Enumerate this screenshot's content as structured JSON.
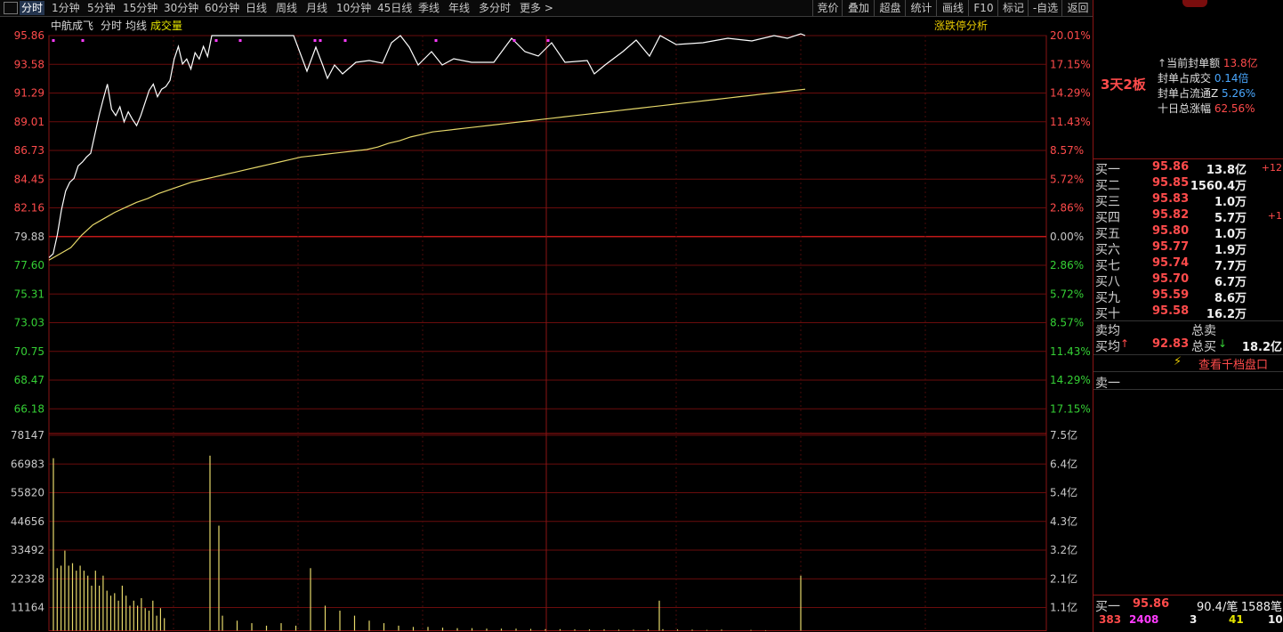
{
  "toolbar": {
    "tabs": [
      "分时",
      "1分钟",
      "5分钟",
      "15分钟",
      "30分钟",
      "60分钟",
      "日线",
      "周线",
      "月线",
      "10分钟",
      "45日线",
      "季线",
      "年线",
      "多分时",
      "更多 >"
    ],
    "active_tab": "分时",
    "right_buttons": [
      "竞价",
      "叠加",
      "超盘",
      "统计",
      "画线",
      "F10",
      "标记",
      "-自选",
      "返回"
    ]
  },
  "chart_header": {
    "stock_name": "中航成飞",
    "labels": [
      "分时",
      "均线",
      "成交量"
    ],
    "right_label": "涨跌停分析"
  },
  "price_axis": {
    "left": [
      "95.86",
      "93.58",
      "91.29",
      "89.01",
      "86.73",
      "84.45",
      "82.16",
      "79.88",
      "77.60",
      "75.31",
      "73.03",
      "70.75",
      "68.47",
      "66.18"
    ],
    "right": [
      "20.01%",
      "17.15%",
      "14.29%",
      "11.43%",
      "8.57%",
      "5.72%",
      "2.86%",
      "0.00%",
      "2.86%",
      "5.72%",
      "8.57%",
      "11.43%",
      "14.29%",
      "17.15%"
    ]
  },
  "volume_axis": {
    "left": [
      "78147",
      "66983",
      "55820",
      "44656",
      "33492",
      "22328",
      "11164"
    ],
    "right": [
      "7.5亿",
      "6.4亿",
      "5.4亿",
      "4.3亿",
      "3.2亿",
      "2.1亿",
      "1.1亿"
    ]
  },
  "chart_data": {
    "type": "line",
    "prev_close": 79.88,
    "ylim": [
      66.18,
      95.86
    ],
    "x_minutes": 240,
    "series": [],
    "price": [
      78.2,
      78.5,
      80,
      82,
      83.5,
      84.2,
      84.5,
      85.5,
      85.8,
      86.2,
      86.5,
      88,
      89.5,
      90.8,
      92,
      90,
      89.5,
      90.2,
      89,
      89.8,
      89.2,
      88.7,
      89.5,
      90.5,
      91.5,
      92,
      91,
      91.6,
      91.8,
      92.3,
      94,
      95,
      93.6,
      94,
      93.2,
      94.5,
      94,
      95,
      94.2,
      95.86,
      95.86,
      95.86,
      95.86,
      95.86,
      95.86,
      95.86,
      95.86,
      95.86,
      95.86,
      95.86,
      95.86,
      95.86,
      95.86,
      95.86,
      95.86,
      95.86,
      95.86,
      95.86,
      95.86,
      95.86,
      95.86,
      95.86,
      95.86,
      95.86,
      95.86,
      95.86,
      95.86,
      95.86,
      95.86,
      95.86,
      95.86,
      95.86,
      95.86,
      95.86,
      95.86,
      95.86,
      95.86,
      95.86,
      95.86,
      95.86,
      95.86,
      95.86,
      95.86,
      95.86,
      95.86,
      95.86,
      95.86,
      95.86,
      95.86,
      95.86,
      95.86,
      95.86,
      95.86,
      95.86,
      95.86,
      95.86,
      95.86,
      95.86,
      95.86,
      95.86,
      95.86,
      95.86,
      95.86,
      95.86,
      95.86,
      95.86,
      95.86,
      95.86,
      95.86,
      95.86,
      95.86,
      95.86,
      95.86,
      95.86,
      95.86,
      95.86,
      95.86,
      95.86,
      95.86,
      95.86,
      95.86,
      95.86,
      95.86,
      95.86,
      95.86,
      95.86,
      95.86,
      95.86,
      95.86,
      95.86,
      95.86,
      95.86,
      95.86,
      95.86,
      95.86,
      95.86,
      95.86,
      95.86,
      95.86,
      95.86,
      95.86,
      95.86,
      95.86,
      95.86,
      95.86,
      95.86,
      95.86,
      95.86,
      95.86,
      95.86,
      95.86,
      95.86,
      95.86,
      95.86,
      95.86,
      95.86,
      95.86,
      95.86,
      95.86,
      95.86,
      95.86,
      95.86,
      95.86,
      95.86,
      95.86,
      95.86,
      95.86,
      95.86,
      95.86,
      95.86,
      95.86,
      95.86,
      95.86,
      95.86,
      95.86,
      95.86,
      95.86,
      95.86,
      95.86,
      95.86,
      95.86,
      95.86,
      95.86,
      95.86,
      95.86,
      95.86,
      95.86,
      95.86,
      95.86,
      95.86,
      95.86,
      95.86,
      95.86,
      95.86,
      95.86,
      95.86,
      95.86,
      95.86,
      95.86,
      95.86,
      95.86,
      95.86,
      95.86,
      95.86,
      95.86,
      95.86,
      95.86,
      95.86,
      95.86,
      95.86,
      95.86,
      95.86,
      95.86,
      95.86,
      95.86,
      95.86,
      95.86,
      95.86,
      95.86
    ],
    "avg": [
      78,
      78.5,
      79,
      80,
      80.8,
      81.3,
      81.8,
      82.2,
      82.6,
      82.9,
      83.3,
      83.6,
      83.9,
      84.2,
      84.4,
      84.6,
      84.8,
      85,
      85.2,
      85.4,
      85.6,
      85.8,
      86,
      86.2,
      86.3,
      86.4,
      86.5,
      86.6,
      86.7,
      86.8,
      87,
      87.3,
      87.5,
      87.8,
      88,
      88.2,
      88.3,
      88.4,
      88.5,
      88.6,
      88.7,
      88.8,
      88.9,
      89,
      89.1,
      89.2,
      89.3,
      89.4,
      89.5,
      89.6,
      89.7,
      89.8,
      89.9,
      90,
      90.1,
      90.2,
      90.3,
      90.4,
      90.5,
      90.6,
      90.7,
      90.8,
      90.9,
      91,
      91.1,
      91.2,
      91.3,
      91.4,
      91.5,
      91.6
    ],
    "volume": [
      69000,
      25000,
      26000,
      32000,
      26000,
      27000,
      24000,
      26000,
      24000,
      22000,
      18000,
      24000,
      18000,
      22000,
      16000,
      14000,
      15000,
      12000,
      18000,
      14000,
      10000,
      12000,
      10000,
      13000,
      9000,
      8000,
      12000,
      6000,
      9000,
      5000,
      70000,
      42000,
      6000,
      4000,
      3000,
      2000,
      3000,
      2000,
      25000,
      10000,
      8000,
      6000,
      4000,
      3000,
      2000,
      1500,
      1500,
      1200,
      1000,
      1000,
      800,
      800,
      800,
      700,
      600,
      600,
      500,
      500,
      500,
      400,
      400,
      500,
      600,
      500,
      400,
      300,
      400,
      12000,
      300,
      200,
      22000
    ]
  },
  "right_panel": {
    "info": [
      {
        "label": "当前封单额",
        "value": "13.8亿"
      },
      {
        "label": "封单占成交",
        "value": "0.14倍"
      },
      {
        "label": "封单占流通Z",
        "value": "5.26%"
      },
      {
        "label": "十日总涨幅",
        "value": "62.56%"
      }
    ],
    "tag": "3天2板",
    "order_book": [
      {
        "label": "买一",
        "price": "95.86",
        "vol": "13.8亿",
        "delta": "+12"
      },
      {
        "label": "买二",
        "price": "95.85",
        "vol": "1560.4万",
        "delta": ""
      },
      {
        "label": "买三",
        "price": "95.83",
        "vol": "1.0万",
        "delta": ""
      },
      {
        "label": "买四",
        "price": "95.82",
        "vol": "5.7万",
        "delta": "+1"
      },
      {
        "label": "买五",
        "price": "95.80",
        "vol": "1.0万",
        "delta": ""
      },
      {
        "label": "买六",
        "price": "95.77",
        "vol": "1.9万",
        "delta": ""
      },
      {
        "label": "买七",
        "price": "95.74",
        "vol": "7.7万",
        "delta": ""
      },
      {
        "label": "买八",
        "price": "95.70",
        "vol": "6.7万",
        "delta": ""
      },
      {
        "label": "买九",
        "price": "95.59",
        "vol": "8.6万",
        "delta": ""
      },
      {
        "label": "买十",
        "price": "95.58",
        "vol": "16.2万",
        "delta": ""
      }
    ],
    "sell_avg_label": "卖均",
    "sell_total_label": "总卖",
    "buy_avg_label": "买均",
    "buy_avg_value": "92.83",
    "buy_total_label": "总买",
    "buy_total_value": "18.2亿",
    "link": "查看千档盘口",
    "sell_one_label": "卖一",
    "bottom": {
      "label": "买一",
      "price": "95.86",
      "avg": "90.4/笔",
      "count": "1588笔"
    },
    "bottom_nums": [
      "383",
      "2408",
      "3",
      "41",
      "10"
    ]
  }
}
